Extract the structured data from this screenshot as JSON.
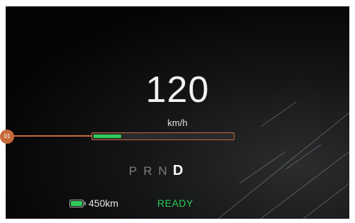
{
  "dashboard": {
    "speed": "120",
    "speed_unit": "km/h",
    "progress_marker_label": "01",
    "power_level_fraction": 0.2,
    "gears": [
      {
        "label": "P",
        "active": false
      },
      {
        "label": "R",
        "active": false
      },
      {
        "label": "N",
        "active": false
      },
      {
        "label": "D",
        "active": true
      }
    ],
    "range": "450km",
    "battery_icon": "battery-icon",
    "status": "READY"
  },
  "colors": {
    "accent_orange": "#c8693a",
    "status_green": "#2ecc56",
    "background": "#050505"
  }
}
